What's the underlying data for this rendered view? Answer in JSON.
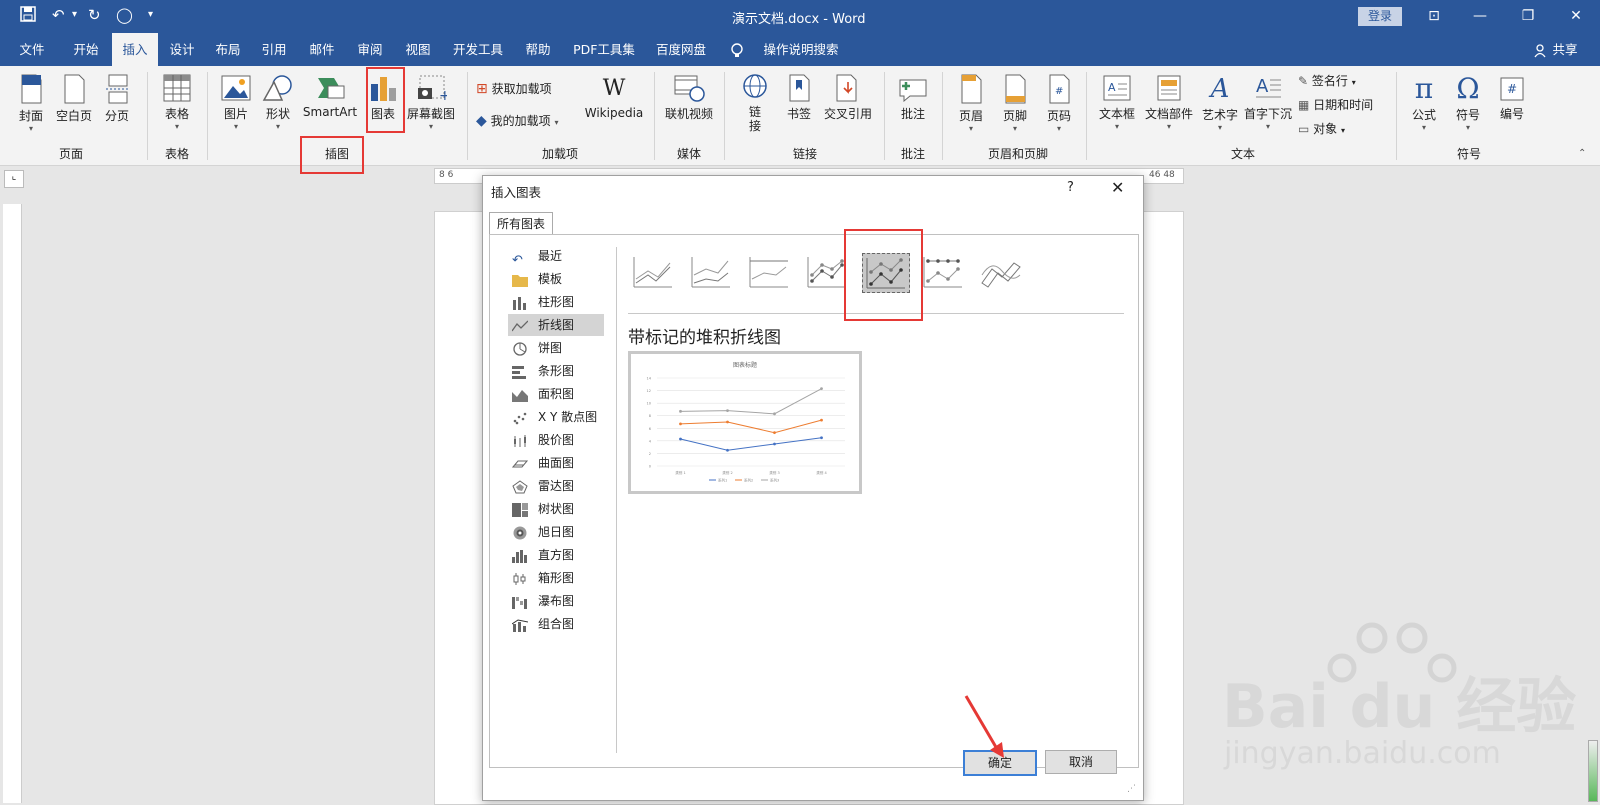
{
  "titlebar": {
    "title": "演示文档.docx  -  Word",
    "login": "登录"
  },
  "tabs": [
    "文件",
    "开始",
    "插入",
    "设计",
    "布局",
    "引用",
    "邮件",
    "审阅",
    "视图",
    "开发工具",
    "帮助",
    "PDF工具集",
    "百度网盘"
  ],
  "tell_me": "操作说明搜索",
  "share": "共享",
  "ribbon": {
    "pages_group": {
      "label": "页面",
      "buttons": [
        "封面",
        "空白页",
        "分页"
      ]
    },
    "table_group": {
      "label": "表格",
      "buttons": [
        "表格"
      ]
    },
    "illustrations_group": {
      "label": "插图",
      "buttons": [
        "图片",
        "形状",
        "SmartArt",
        "图表",
        "屏幕截图"
      ]
    },
    "addins_group": {
      "label": "加载项",
      "get": "获取加载项",
      "mine": "我的加载项",
      "wiki": "Wikipedia"
    },
    "media_group": {
      "label": "媒体",
      "buttons": [
        "联机视频"
      ]
    },
    "links_group": {
      "label": "链接",
      "buttons": [
        "链接",
        "书签",
        "交叉引用"
      ]
    },
    "comments_group": {
      "label": "批注",
      "buttons": [
        "批注"
      ]
    },
    "hf_group": {
      "label": "页眉和页脚",
      "buttons": [
        "页眉",
        "页脚",
        "页码"
      ]
    },
    "text_group": {
      "label": "文本",
      "buttons": [
        "文本框",
        "文档部件",
        "艺术字",
        "首字下沉"
      ],
      "small": [
        "签名行",
        "日期和时间",
        "对象"
      ]
    },
    "symbols_group": {
      "label": "符号",
      "buttons": [
        "公式",
        "符号",
        "编号"
      ]
    }
  },
  "ruler": {
    "left": "8  6",
    "right": "46  48"
  },
  "dialog": {
    "title": "插入图表",
    "help": "?",
    "tab": "所有图表",
    "categories": [
      "最近",
      "模板",
      "柱形图",
      "折线图",
      "饼图",
      "条形图",
      "面积图",
      "X Y 散点图",
      "股价图",
      "曲面图",
      "雷达图",
      "树状图",
      "旭日图",
      "直方图",
      "箱形图",
      "瀑布图",
      "组合图"
    ],
    "selected_category": "折线图",
    "selected_subtype": "带标记的堆积折线图",
    "ok": "确定",
    "cancel": "取消",
    "preview": {
      "title": "图表标题",
      "ytick": [
        "14",
        "12",
        "10",
        "8",
        "6",
        "4",
        "2",
        "0"
      ],
      "xcats": [
        "类别 1",
        "类别 2",
        "类别 3",
        "类别 4"
      ],
      "legend": [
        "系列1",
        "系列2",
        "系列3"
      ]
    }
  },
  "chart_data": {
    "type": "line",
    "title": "图表标题",
    "categories": [
      "类别 1",
      "类别 2",
      "类别 3",
      "类别 4"
    ],
    "series": [
      {
        "name": "系列1",
        "values": [
          4.3,
          2.5,
          3.5,
          4.5
        ],
        "color": "#4472c4"
      },
      {
        "name": "系列2",
        "values": [
          6.7,
          7,
          5.3,
          7.3
        ],
        "color": "#ed7d31"
      },
      {
        "name": "系列3",
        "values": [
          8.7,
          8.8,
          8.3,
          12.3
        ],
        "color": "#a5a5a5"
      }
    ],
    "ylim": [
      0,
      14
    ],
    "grid": true,
    "legend": "bottom"
  },
  "watermark": {
    "brand": "Bai du 经验",
    "url": "jingyan.baidu.com"
  },
  "colors": {
    "accent": "#2b579a",
    "highlight": "#e53935"
  }
}
